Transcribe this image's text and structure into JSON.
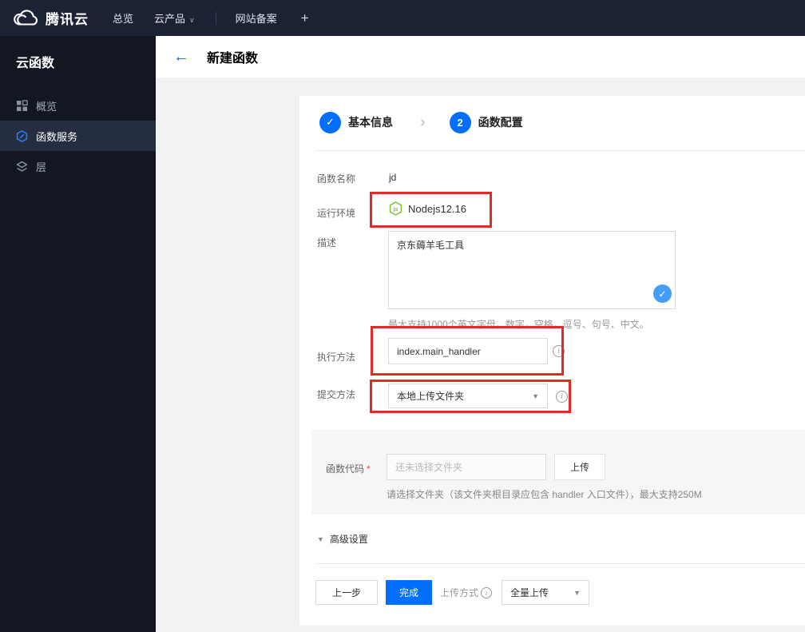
{
  "icons": {
    "back": "←",
    "check": "✓",
    "chevron": "›",
    "caret_down": "▼",
    "nav_caret": "∨",
    "info": "i",
    "required_mark": "*"
  },
  "topbar": {
    "brand": "腾讯云",
    "nav": [
      {
        "label": "总览"
      },
      {
        "label": "云产品"
      },
      {
        "label": "网站备案"
      },
      {
        "label": "+"
      }
    ]
  },
  "sidebar": {
    "title": "云函数",
    "items": [
      {
        "label": "概览",
        "icon": "grid-icon",
        "active": false
      },
      {
        "label": "函数服务",
        "icon": "function-icon",
        "active": true
      },
      {
        "label": "层",
        "icon": "layers-icon",
        "active": false
      }
    ]
  },
  "header": {
    "title": "新建函数"
  },
  "steps": [
    {
      "label": "基本信息",
      "state": "done"
    },
    {
      "label": "函数配置",
      "state": "current",
      "number": "2"
    }
  ],
  "form": {
    "name": {
      "label": "函数名称",
      "value": "jd"
    },
    "runtime": {
      "label": "运行环境",
      "value": "Nodejs12.16",
      "icon": "nodejs-icon"
    },
    "description": {
      "label": "描述",
      "value": "京东薅羊毛工具",
      "helper": "最大支持1000个英文字母，数字，空格，逗号、句号、中文。"
    },
    "handler": {
      "label": "执行方法",
      "value": "index.main_handler"
    },
    "submit_method": {
      "label": "提交方法",
      "value": "本地上传文件夹"
    },
    "code": {
      "label": "函数代码",
      "placeholder": "还未选择文件夹",
      "upload_label": "上传",
      "helper": "请选择文件夹（该文件夹根目录应包含 handler 入口文件），最大支持250M"
    },
    "advanced_label": "高级设置"
  },
  "footer": {
    "prev_label": "上一步",
    "finish_label": "完成",
    "upload_mode_label": "上传方式",
    "upload_mode_value": "全量上传"
  },
  "colors": {
    "topbar_bg": "#1b2233",
    "sidebar_bg": "#131722",
    "sidebar_active_bg": "#252e40",
    "accent_blue": "#006eff",
    "badge_blue": "#459df5",
    "annotation_red": "#e12b27",
    "node_green": "#7fbf3f",
    "page_bg": "#f2f2f2",
    "section_bg": "#f5f6f7"
  }
}
